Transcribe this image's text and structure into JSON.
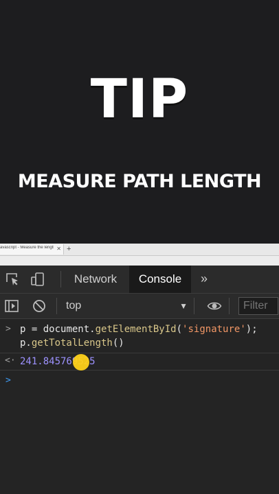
{
  "overlay": {
    "title": "TIP",
    "subtitle": "MEASURE PATH LENGTH"
  },
  "browser": {
    "tab_title": "avascript - Measure the length o",
    "close_glyph": "✕",
    "new_tab_glyph": "+"
  },
  "devtools": {
    "tabs": [
      {
        "label": "Network",
        "active": false
      },
      {
        "label": "Console",
        "active": true
      }
    ],
    "more_tabs_glyph": "»",
    "context": {
      "selected": "top",
      "arrow": "▼"
    },
    "filter": {
      "placeholder": "Filter"
    },
    "console": {
      "input_prompt": ">",
      "input_lines": [
        "p = document.getElementById('signature');",
        "p.getTotalLength()"
      ],
      "input_tokens": {
        "var": "p",
        "eq": " = document.",
        "fn1": "getElementById",
        "open": "(",
        "arg": "'signature'",
        "close": ");",
        "line2_var": "p.",
        "fn2": "getTotalLength",
        "line2_close": "()"
      },
      "output_prompt": "<·",
      "output_value": "241.845769525",
      "new_prompt": ">"
    },
    "icons": [
      "inspect-element-icon",
      "device-toolbar-icon",
      "sidebar-toggle-icon",
      "clear-console-icon",
      "eye-icon"
    ],
    "colors": {
      "panel": "#242424",
      "toolbar": "#2b2b2b",
      "number": "#9d92ff",
      "string": "#f29766",
      "function": "#d9c78a",
      "prompt_blue": "#3e9cf4",
      "cursor_highlight": "#ffd21a"
    }
  }
}
